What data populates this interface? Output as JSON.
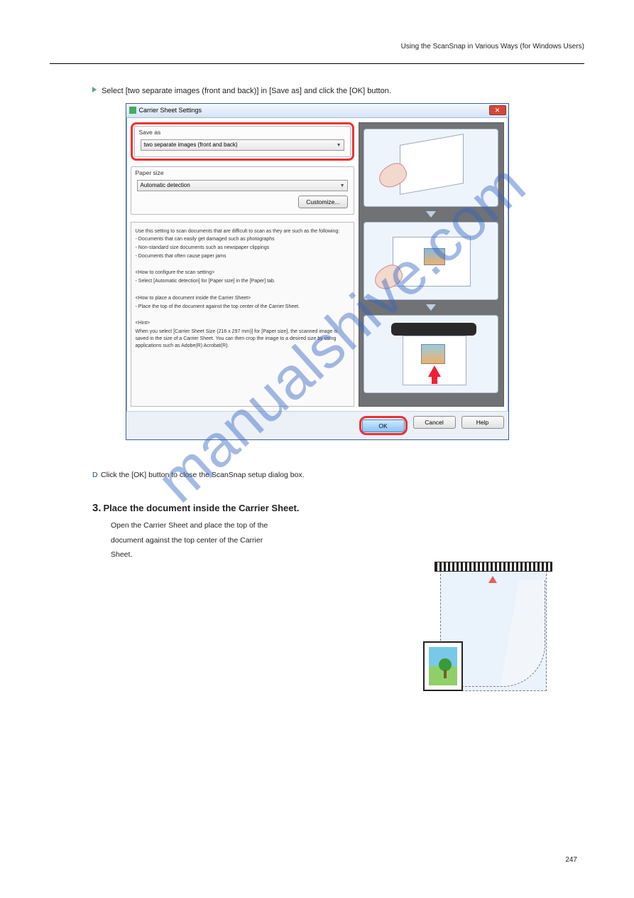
{
  "header": {
    "rightText": "Using the ScanSnap in Various Ways (for Windows Users)"
  },
  "stepIntro": "Select [two separate images (front and back)] in [Save as] and click the [OK] button.",
  "dialog": {
    "title": "Carrier Sheet Settings",
    "saveAs": {
      "label": "Save as",
      "value": "two separate images (front and back)"
    },
    "paperSize": {
      "label": "Paper size",
      "value": "Automatic detection"
    },
    "customizeBtn": "Customize...",
    "instructions": {
      "p1": "Use this setting to scan documents that are difficult to scan as they are such as the following:",
      "b1": "- Documents that can easily get damaged such as photographs",
      "b2": "- Non-standard size documents such as newspaper clippings",
      "b3": "- Documents that often cause paper jams",
      "h2": "<How to configure the scan setting>",
      "b4": "- Select [Automatic detection] for [Paper size] in the [Paper] tab.",
      "h3": "<How to place a document inside the Carrier Sheet>",
      "b5": "- Place the top of the document against the top center of the Carrier Sheet.",
      "h4": "<Hint>",
      "b6": "When you select [Carrier Sheet Size (216 x 297 mm)] for [Paper size], the scanned image is saved in the size of a Carrier Sheet. You can then crop the image to a desired size by using applications such as Adobe(R) Acrobat(R)."
    },
    "buttons": {
      "ok": "OK",
      "cancel": "Cancel",
      "help": "Help"
    }
  },
  "midContent": {
    "line1": "Click the [OK] button to close the ScanSnap setup dialog box.",
    "stepNum": "3.",
    "stepTitle": "Place the document inside the Carrier Sheet.",
    "sub1": "Open the Carrier Sheet and place the top of the",
    "sub2": "document against the top center of the Carrier",
    "sub3": "Sheet."
  },
  "pageNum": "247",
  "watermark": "manualshive.com"
}
